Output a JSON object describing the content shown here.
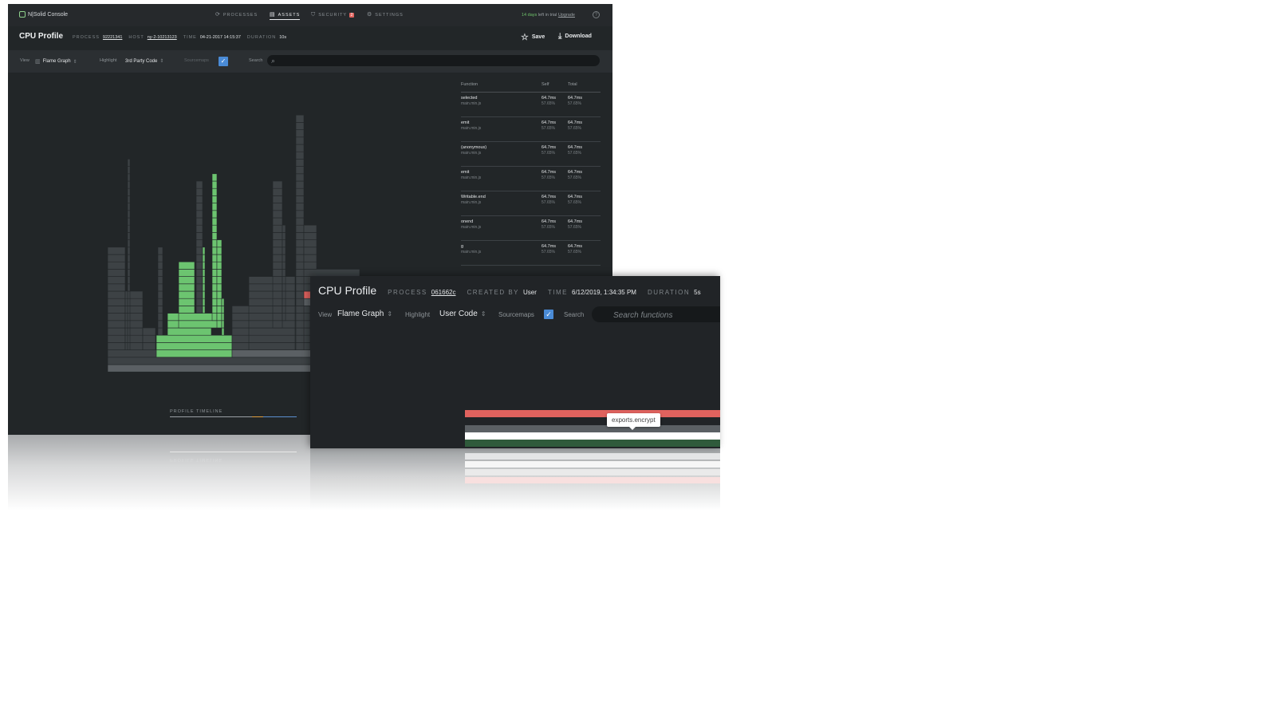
{
  "back_window": {
    "brand": "N|Solid Console",
    "nav": [
      {
        "label": "PROCESSES",
        "icon": "processes-icon"
      },
      {
        "label": "ASSETS",
        "icon": "assets-icon"
      },
      {
        "label": "SECURITY",
        "icon": "security-icon",
        "badge": "2"
      },
      {
        "label": "SETTINGS",
        "icon": "settings-icon"
      }
    ],
    "trial": {
      "days": "14 days",
      "text": " left in trial ",
      "link": "Upgrade"
    },
    "help_icon": "?",
    "title": "CPU Profile",
    "meta": {
      "process_label": "PROCESS",
      "process": "92221341",
      "host_label": "HOST",
      "host": "ny-2-10213123",
      "time_label": "TIME",
      "time": "04-21-2017 14:15:37",
      "duration_label": "DURATION",
      "duration": "10s"
    },
    "save_label": "Save",
    "download_label": "Download",
    "toolbar": {
      "view_label": "View",
      "view_value": "Flame Graph",
      "highlight_label": "Highlight",
      "highlight_value": "3rd Party Code",
      "sourcemaps_label": "Sourcemaps",
      "search_label": "Search"
    },
    "timeline_label": "PROFILE TIMELINE",
    "table": {
      "headers": [
        "Function",
        "Self",
        "Total"
      ],
      "rows": [
        {
          "name": "selected",
          "file": "main.min.js",
          "self": "64.7ms",
          "self_pct": "57.65%",
          "total": "64.7ms",
          "total_pct": "57.65%"
        },
        {
          "name": "emit",
          "file": "main.min.js",
          "self": "64.7ms",
          "self_pct": "57.65%",
          "total": "64.7ms",
          "total_pct": "57.65%"
        },
        {
          "name": "(anonymous)",
          "file": "main.min.js",
          "self": "64.7ms",
          "self_pct": "57.65%",
          "total": "64.7ms",
          "total_pct": "57.65%"
        },
        {
          "name": "emit",
          "file": "main.min.js",
          "self": "64.7ms",
          "self_pct": "57.65%",
          "total": "64.7ms",
          "total_pct": "57.65%"
        },
        {
          "name": "Writable.end",
          "file": "main.min.js",
          "self": "64.7ms",
          "self_pct": "57.65%",
          "total": "64.7ms",
          "total_pct": "57.65%"
        },
        {
          "name": "onend",
          "file": "main.min.js",
          "self": "64.7ms",
          "self_pct": "57.65%",
          "total": "64.7ms",
          "total_pct": "57.65%"
        },
        {
          "name": "g",
          "file": "main.min.js",
          "self": "64.7ms",
          "self_pct": "57.65%",
          "total": "64.7ms",
          "total_pct": "57.65%"
        }
      ]
    }
  },
  "front_window": {
    "title": "CPU Profile",
    "meta": {
      "process_label": "PROCESS",
      "process": "061662c",
      "created_label": "CREATED BY",
      "created": "User",
      "time_label": "TIME",
      "time": "6/12/2019, 1:34:35 PM",
      "duration_label": "DURATION",
      "duration": "5s"
    },
    "toolbar": {
      "view_label": "View",
      "view_value": "Flame Graph",
      "highlight_label": "Highlight",
      "highlight_value": "User Code",
      "sourcemaps_label": "Sourcemaps",
      "search_label": "Search",
      "search_placeholder": "Search functions"
    },
    "tooltip": "exports.encrypt"
  },
  "colors": {
    "bg_dark": "#222628",
    "flame_gray": "#3d4245",
    "flame_light_gray": "#5b6064",
    "flame_green": "#6cc470",
    "flame_red": "#e0625e",
    "flame_dark_green": "#2f5a3b",
    "accent_blue": "#4a8bd6",
    "trial_green": "#6fc26b"
  }
}
